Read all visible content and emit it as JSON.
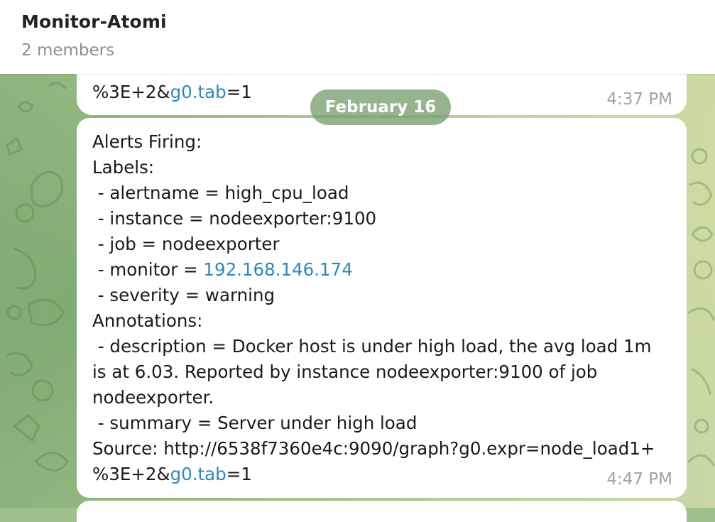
{
  "header": {
    "title": "Monitor-Atomi",
    "subtitle": "2 members"
  },
  "date_separator": "February 16",
  "previous_message": {
    "text_before_link": "%3E+2&",
    "link": "g0.tab",
    "text_after_link": "=1",
    "time": "4:37 PM"
  },
  "message": {
    "lines": [
      "Alerts Firing:",
      "Labels:",
      " - alertname = high_cpu_load",
      " - instance = nodeexporter:9100",
      " - job = nodeexporter"
    ],
    "monitor_label": " - monitor = ",
    "monitor_link": "192.168.146.174",
    "severity_line": " - severity = warning",
    "annotations_label": "Annotations:",
    "description": " - description = Docker host is under high load, the avg load 1m is at 6.03. Reported by instance nodeexporter:9100 of job nodeexporter.",
    "summary": " - summary = Server under high load",
    "source_line": "Source: http://6538f7360e4c:9090/graph?g0.expr=node_load1+",
    "source_tail_before_link": "%3E+2&",
    "source_tail_link": "g0.tab",
    "source_tail_after_link": "=1",
    "time": "4:47 PM"
  },
  "colors": {
    "link": "#2e87c4",
    "bubble": "#ffffff",
    "date_pill": "#78a06e"
  }
}
